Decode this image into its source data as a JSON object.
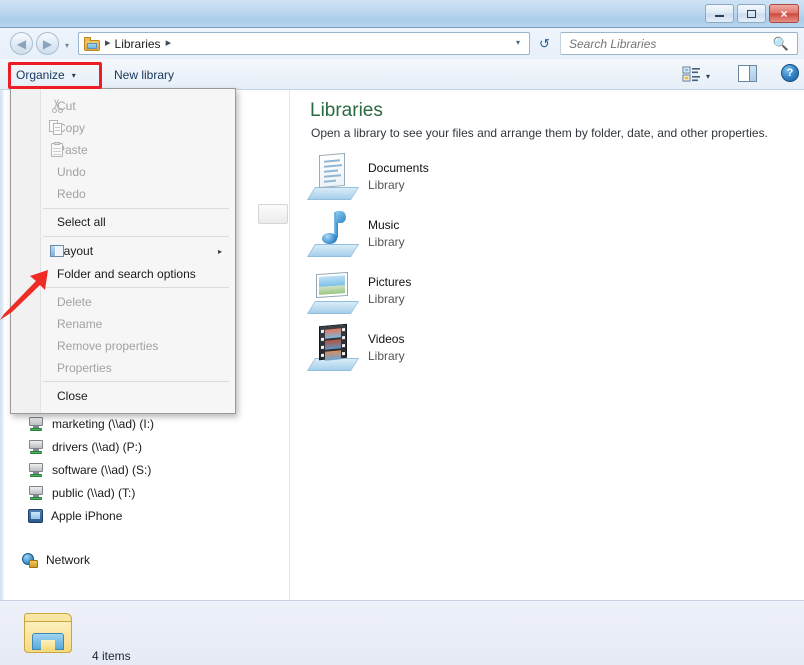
{
  "window": {
    "controls": {
      "minimize_label": "Minimize",
      "maximize_label": "Maximize",
      "close_label": "×"
    }
  },
  "navigation": {
    "back_label": "◀",
    "forward_label": "▶",
    "recent_pages_label": "▾",
    "address": {
      "folder_icon": "libraries-folder-icon",
      "separator": "▸",
      "crumbs": [
        "Libraries"
      ],
      "dropdown_label": "▾"
    },
    "refresh_label": "↺",
    "search": {
      "placeholder": "Search Libraries",
      "value": "",
      "icon": "search-icon"
    }
  },
  "toolbar": {
    "organize_label": "Organize",
    "organize_caret": "▾",
    "new_library_label": "New library",
    "view_caret": "▾",
    "help_label": "?"
  },
  "organize_menu": {
    "groups": [
      {
        "items": [
          {
            "label": "Cut",
            "enabled": false,
            "icon": "scissors-icon"
          },
          {
            "label": "Copy",
            "enabled": false,
            "icon": "copy-icon"
          },
          {
            "label": "Paste",
            "enabled": false,
            "icon": "clipboard-icon"
          },
          {
            "label": "Undo",
            "enabled": false,
            "icon": ""
          },
          {
            "label": "Redo",
            "enabled": false,
            "icon": ""
          }
        ]
      },
      {
        "items": [
          {
            "label": "Select all",
            "enabled": true,
            "icon": ""
          }
        ]
      },
      {
        "items": [
          {
            "label": "Layout",
            "enabled": true,
            "icon": "layout-icon",
            "submenu": true
          },
          {
            "label": "Folder and search options",
            "enabled": true,
            "icon": ""
          }
        ]
      },
      {
        "items": [
          {
            "label": "Delete",
            "enabled": false,
            "icon": ""
          },
          {
            "label": "Rename",
            "enabled": false,
            "icon": ""
          },
          {
            "label": "Remove properties",
            "enabled": false,
            "icon": ""
          },
          {
            "label": "Properties",
            "enabled": false,
            "icon": ""
          }
        ]
      },
      {
        "items": [
          {
            "label": "Close",
            "enabled": true,
            "icon": ""
          }
        ]
      }
    ],
    "submenu_arrow": "▸"
  },
  "nav_pane": {
    "items": [
      {
        "label": "marketing (\\\\ad) (I:)",
        "icon": "network-drive-icon"
      },
      {
        "label": "drivers (\\\\ad) (P:)",
        "icon": "network-drive-icon"
      },
      {
        "label": "software (\\\\ad) (S:)",
        "icon": "network-drive-icon"
      },
      {
        "label": "public (\\\\ad) (T:)",
        "icon": "network-drive-icon"
      },
      {
        "label": "Apple iPhone",
        "icon": "phone-icon"
      },
      {
        "label": "Network",
        "icon": "network-icon"
      }
    ]
  },
  "content": {
    "title": "Libraries",
    "subtitle": "Open a library to see your files and arrange them by folder, date, and other properties.",
    "libraries": [
      {
        "name": "Documents",
        "kind": "Library",
        "icon": "documents-library-icon"
      },
      {
        "name": "Music",
        "kind": "Library",
        "icon": "music-library-icon"
      },
      {
        "name": "Pictures",
        "kind": "Library",
        "icon": "pictures-library-icon"
      },
      {
        "name": "Videos",
        "kind": "Library",
        "icon": "videos-library-icon"
      }
    ]
  },
  "status_bar": {
    "item_count_text": "4 items",
    "icon": "libraries-folder-icon"
  },
  "annotations": {
    "highlight_color": "#ee1c25",
    "highlight_target": "Organize",
    "arrow_color": "#ee2b24",
    "arrow_target": "Folder and search options"
  }
}
